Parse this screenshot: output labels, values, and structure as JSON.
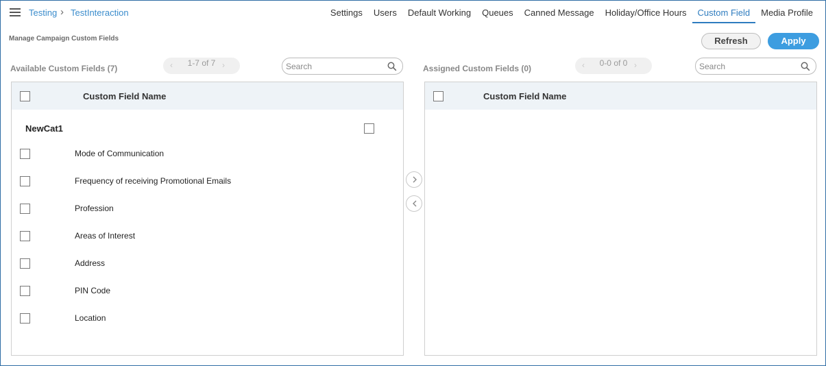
{
  "header": {
    "breadcrumb": [
      "Testing",
      "TestInteraction"
    ],
    "nav": [
      "Settings",
      "Users",
      "Default Working",
      "Queues",
      "Canned Message",
      "Holiday/Office Hours",
      "Custom Field",
      "Media Profile"
    ],
    "active_tab": "Custom Field"
  },
  "page": {
    "subtitle": "Manage Campaign Custom Fields",
    "refresh_label": "Refresh",
    "apply_label": "Apply"
  },
  "available": {
    "title": "Available Custom Fields (7)",
    "pager": "1-7 of 7",
    "search_placeholder": "Search",
    "column_header": "Custom Field Name",
    "category": "NewCat1",
    "items": [
      "Mode of Communication",
      "Frequency of receiving Promotional Emails",
      "Profession",
      "Areas of Interest",
      "Address",
      "PIN Code",
      "Location"
    ]
  },
  "assigned": {
    "title": "Assigned Custom Fields (0)",
    "pager": "0-0 of 0",
    "search_placeholder": "Search",
    "column_header": "Custom Field Name"
  },
  "colors": {
    "accent": "#2e7cbf",
    "apply": "#3d9de0",
    "header_bg": "#eef3f7"
  },
  "icons": {
    "menu": "hamburger-icon",
    "search": "search-icon",
    "move_right": "chevron-right-icon",
    "move_left": "chevron-left-icon"
  }
}
